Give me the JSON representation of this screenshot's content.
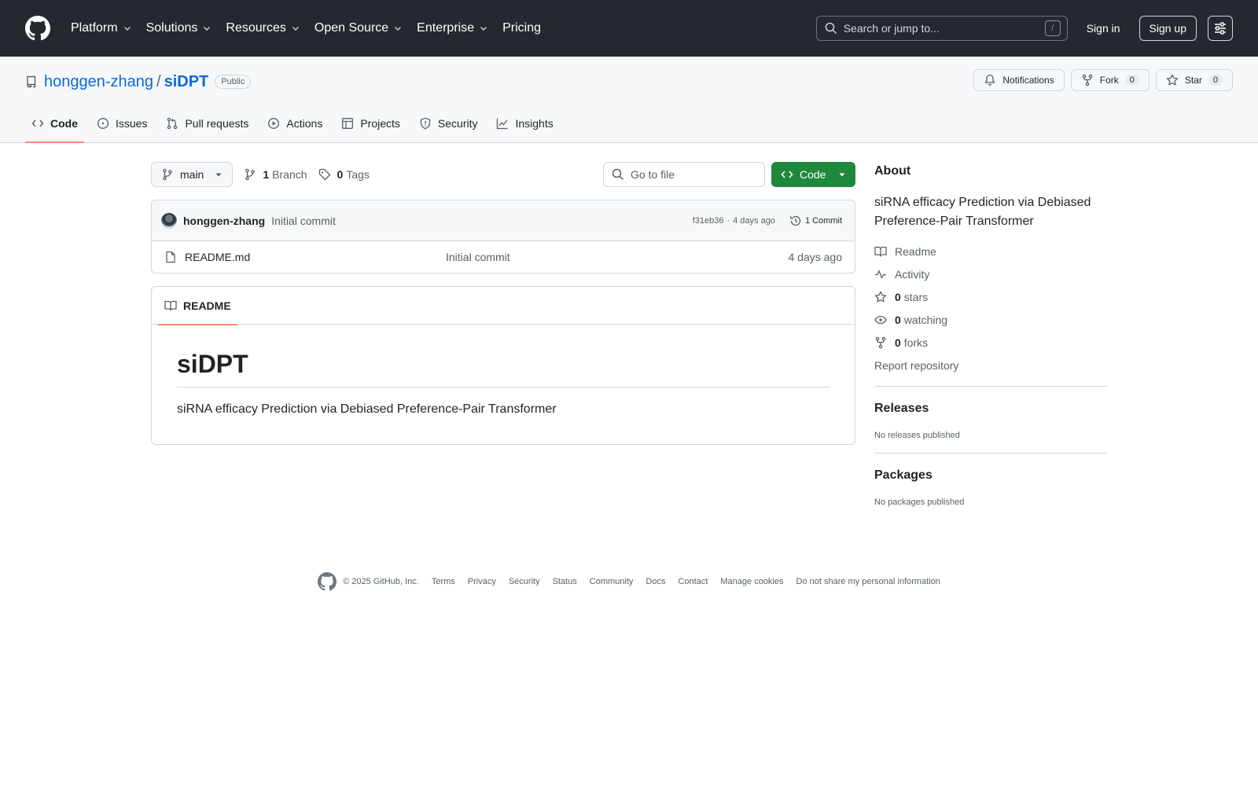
{
  "header": {
    "nav": [
      {
        "label": "Platform",
        "dropdown": true
      },
      {
        "label": "Solutions",
        "dropdown": true
      },
      {
        "label": "Resources",
        "dropdown": true
      },
      {
        "label": "Open Source",
        "dropdown": true
      },
      {
        "label": "Enterprise",
        "dropdown": true
      },
      {
        "label": "Pricing",
        "dropdown": false
      }
    ],
    "search_placeholder": "Search or jump to...",
    "search_key": "/",
    "sign_in": "Sign in",
    "sign_up": "Sign up"
  },
  "repo": {
    "owner": "honggen-zhang",
    "separator": "/",
    "name": "siDPT",
    "visibility": "Public",
    "notifications_label": "Notifications",
    "fork_label": "Fork",
    "fork_count": "0",
    "star_label": "Star",
    "star_count": "0",
    "tabs": [
      {
        "label": "Code",
        "icon": "code-icon",
        "active": true
      },
      {
        "label": "Issues",
        "icon": "issue-icon",
        "active": false
      },
      {
        "label": "Pull requests",
        "icon": "pull-request-icon",
        "active": false
      },
      {
        "label": "Actions",
        "icon": "play-icon",
        "active": false
      },
      {
        "label": "Projects",
        "icon": "table-icon",
        "active": false
      },
      {
        "label": "Security",
        "icon": "shield-icon",
        "active": false
      },
      {
        "label": "Insights",
        "icon": "graph-icon",
        "active": false
      }
    ]
  },
  "toolbar": {
    "branch": "main",
    "branch_count": "1",
    "branch_label": "Branch",
    "tag_count": "0",
    "tag_label": "Tags",
    "goto_placeholder": "Go to file",
    "code_button": "Code"
  },
  "commit": {
    "author": "honggen-zhang",
    "message": "Initial commit",
    "hash": "f31eb36",
    "dot": "·",
    "age": "4 days ago",
    "commits_label": "1 Commit"
  },
  "files": [
    {
      "name": "README.md",
      "message": "Initial commit",
      "age": "4 days ago",
      "icon": "file-icon"
    }
  ],
  "readme": {
    "tab_label": "README",
    "heading": "siDPT",
    "body": "siRNA efficacy Prediction via Debiased Preference-Pair Transformer"
  },
  "about": {
    "title": "About",
    "description": "siRNA efficacy Prediction via Debiased Preference-Pair Transformer",
    "readme": "Readme",
    "activity": "Activity",
    "stars_count": "0",
    "stars_label": "stars",
    "watching_count": "0",
    "watching_label": "watching",
    "forks_count": "0",
    "forks_label": "forks",
    "report": "Report repository"
  },
  "releases": {
    "title": "Releases",
    "note": "No releases published"
  },
  "packages": {
    "title": "Packages",
    "note": "No packages published"
  },
  "footer": {
    "copyright": "© 2025 GitHub, Inc.",
    "links": [
      "Terms",
      "Privacy",
      "Security",
      "Status",
      "Community",
      "Docs",
      "Contact",
      "Manage cookies",
      "Do not share my personal information"
    ]
  },
  "colors": {
    "header_bg": "#24292f",
    "link": "#0969da",
    "primary_button": "#1f883d",
    "active_tab_underline": "#fd8c73"
  }
}
